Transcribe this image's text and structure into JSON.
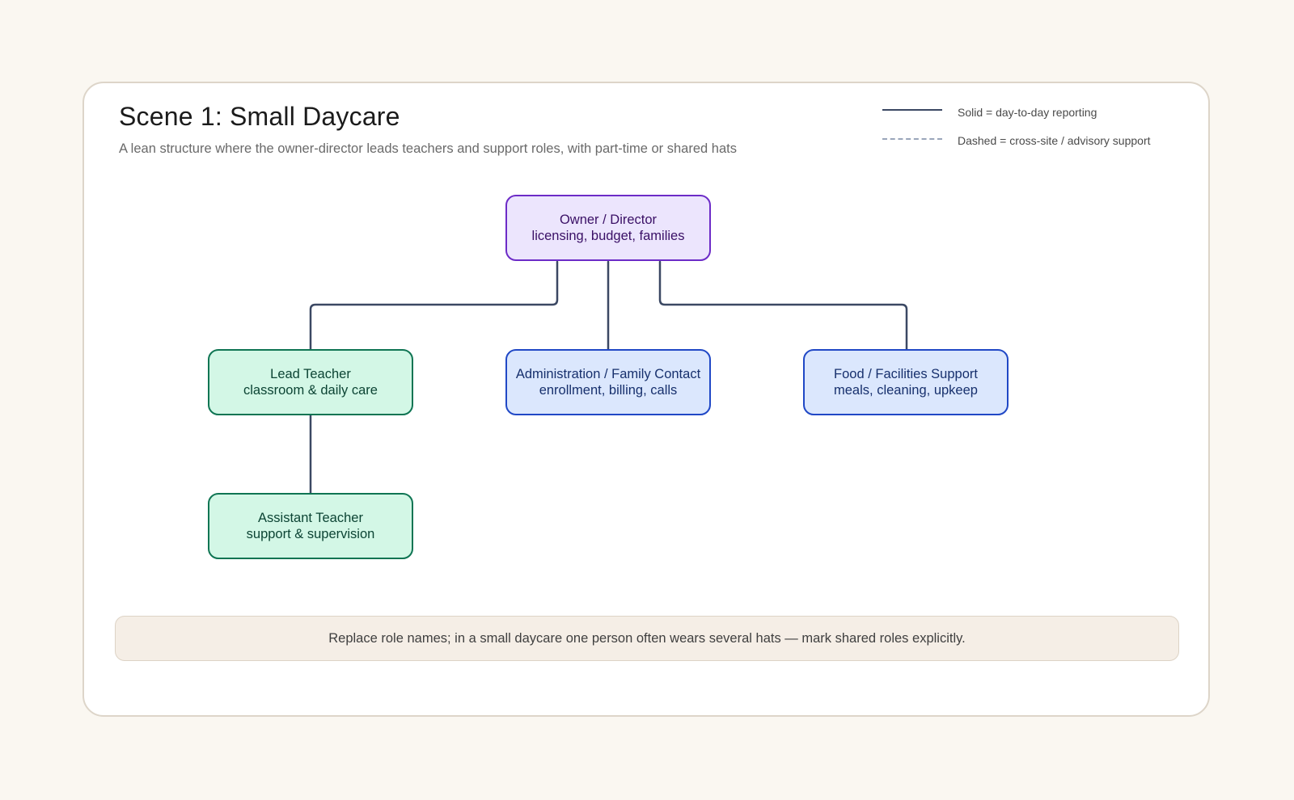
{
  "header": {
    "title": "Scene 1: Small Daycare",
    "subtitle": "A lean structure where the owner-director leads teachers and support roles, with part-time or shared hats"
  },
  "legend": {
    "solid": "Solid = day-to-day reporting",
    "dashed": "Dashed = cross-site / advisory support"
  },
  "nodes": {
    "owner": {
      "title": "Owner / Director",
      "desc": "licensing, budget, families"
    },
    "lead_teacher": {
      "title": "Lead Teacher",
      "desc": "classroom & daily care"
    },
    "admin": {
      "title": "Administration / Family Contact",
      "desc": "enrollment, billing, calls"
    },
    "food": {
      "title": "Food / Facilities Support",
      "desc": "meals, cleaning, upkeep"
    },
    "assistant": {
      "title": "Assistant Teacher",
      "desc": "support & supervision"
    }
  },
  "edges": [
    {
      "from": "Owner / Director",
      "to": "Lead Teacher",
      "style": "solid"
    },
    {
      "from": "Owner / Director",
      "to": "Administration / Family Contact",
      "style": "solid"
    },
    {
      "from": "Owner / Director",
      "to": "Food / Facilities Support",
      "style": "solid"
    },
    {
      "from": "Lead Teacher",
      "to": "Assistant Teacher",
      "style": "solid"
    }
  ],
  "colors": {
    "background": "#faf7f1",
    "connector": "#3b4863",
    "dashed_connector": "#9aa6ba",
    "purple_fill": "#ece5fd",
    "purple_border": "#6c2bc7",
    "green_fill": "#d3f7e6",
    "green_border": "#0f7553",
    "blue_fill": "#dbe7fd",
    "blue_border": "#2048c6"
  },
  "note": "Replace role names; in a small daycare one person often wears several hats — mark shared roles explicitly."
}
